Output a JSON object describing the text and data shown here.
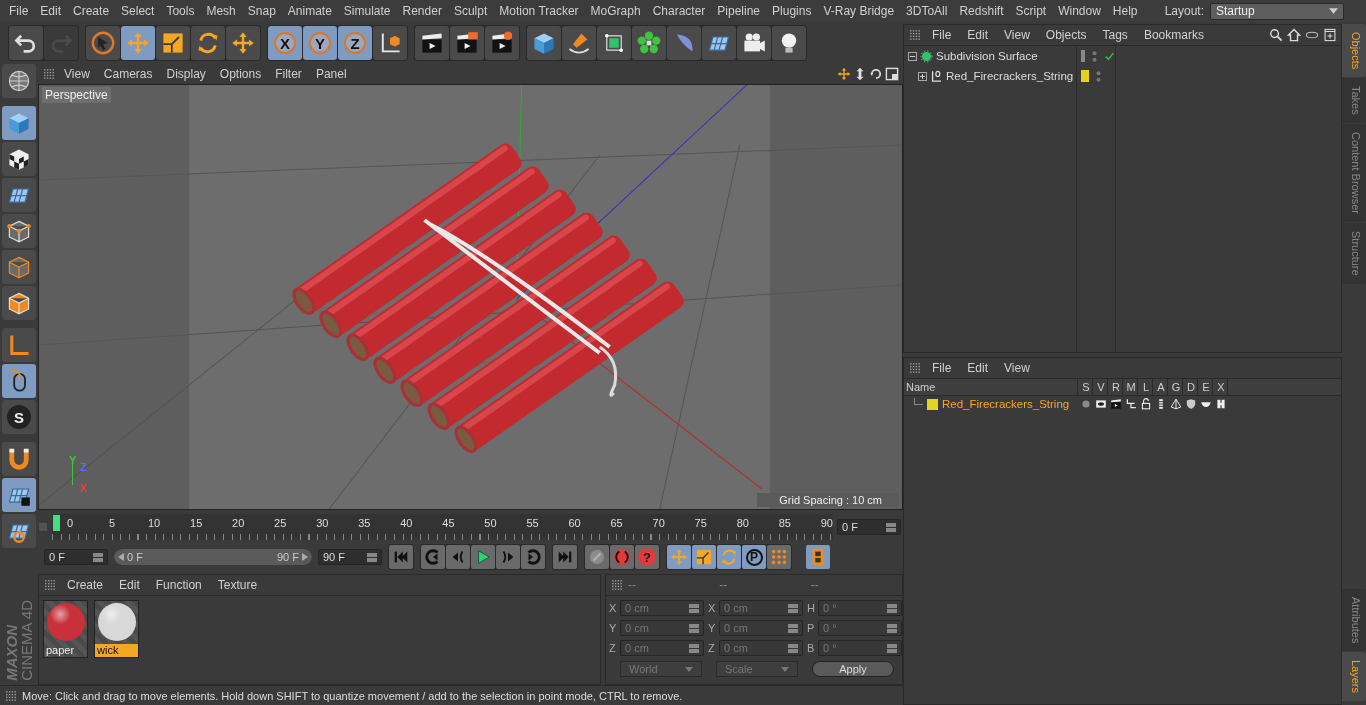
{
  "menubar": {
    "items": [
      "File",
      "Edit",
      "Create",
      "Select",
      "Tools",
      "Mesh",
      "Snap",
      "Animate",
      "Simulate",
      "Render",
      "Sculpt",
      "Motion Tracker",
      "MoGraph",
      "Character",
      "Pipeline",
      "Plugins",
      "V-Ray Bridge",
      "3DToAll",
      "Redshift",
      "Script",
      "Window",
      "Help"
    ],
    "layout_label": "Layout:",
    "layout_value": "Startup"
  },
  "toolbar": {
    "groups": [
      {
        "items": [
          {
            "disabled": false
          },
          {
            "disabled": true
          }
        ]
      },
      {
        "items": [
          {
            "selected": false
          },
          {
            "selected": true
          },
          {
            "selected": false
          },
          {
            "selected": false
          },
          {
            "selected": false
          }
        ]
      },
      {
        "items": [
          {
            "label": "X",
            "selected": true
          },
          {
            "label": "Y",
            "selected": true
          },
          {
            "label": "Z",
            "selected": true
          },
          {
            "selected": false
          }
        ]
      },
      {
        "items": [
          {
            "selected": false
          },
          {
            "selected": false
          },
          {
            "selected": false
          }
        ]
      },
      {
        "items": [
          {
            "selected": false
          },
          {
            "selected": false
          },
          {
            "selected": false
          },
          {
            "selected": false
          },
          {
            "selected": false
          },
          {
            "selected": false
          },
          {
            "selected": false
          },
          {
            "selected": false
          }
        ]
      }
    ]
  },
  "left_toolbar": {
    "tools": [
      {
        "selected": false
      },
      {
        "selected": true
      },
      {
        "selected": false
      },
      {
        "selected": false
      },
      {
        "selected": false
      },
      {
        "selected": false
      },
      {
        "selected": false
      },
      {
        "selected": false
      },
      {
        "selected": true
      },
      {
        "label": "S",
        "selected": false
      },
      {
        "selected": false
      },
      {
        "selected": true
      },
      {
        "selected": false
      }
    ]
  },
  "viewport": {
    "menu": [
      "View",
      "Cameras",
      "Display",
      "Options",
      "Filter",
      "Panel"
    ],
    "camera_label": "Perspective",
    "grid_spacing": "Grid Spacing : 10 cm",
    "axis_labels": [
      {
        "text": "Y",
        "color": "#3ec43e"
      },
      {
        "text": "Z",
        "color": "#5a6cff"
      },
      {
        "text": "X",
        "color": "#e04040"
      }
    ]
  },
  "timeline": {
    "ruler_labels": [
      "0",
      "5",
      "10",
      "15",
      "20",
      "25",
      "30",
      "35",
      "40",
      "45",
      "50",
      "55",
      "60",
      "65",
      "70",
      "75",
      "80",
      "85",
      "90"
    ],
    "current_frame": "0 F",
    "start_field": "0 F",
    "range_start": "0 F",
    "range_end": "90 F",
    "range_slider": {
      "level": 1
    },
    "selection_key_label": "?",
    "end_field": "90 F",
    "key_buttons": [
      {
        "label": "P",
        "selected": true
      }
    ]
  },
  "materials": {
    "menu": [
      "Create",
      "Edit",
      "Function",
      "Texture"
    ],
    "items": [
      {
        "name": "paper",
        "color": "#c8303a",
        "selected": false
      },
      {
        "name": "wick",
        "color": "#d8d8d8",
        "selected": true
      }
    ]
  },
  "coordinates": {
    "headers": [
      "--",
      "--",
      "--"
    ],
    "columns": [
      [
        {
          "axis": "X",
          "value": "0 cm"
        },
        {
          "axis": "Y",
          "value": "0 cm"
        },
        {
          "axis": "Z",
          "value": "0 cm"
        }
      ],
      [
        {
          "axis": "X",
          "value": "0 cm"
        },
        {
          "axis": "Y",
          "value": "0 cm"
        },
        {
          "axis": "Z",
          "value": "0 cm"
        }
      ],
      [
        {
          "axis": "H",
          "value": "0 °"
        },
        {
          "axis": "P",
          "value": "0 °"
        },
        {
          "axis": "B",
          "value": "0 °"
        }
      ]
    ],
    "space": "World",
    "mode": "Scale",
    "apply": "Apply"
  },
  "status_bar": "Move: Click and drag to move elements. Hold down SHIFT to quantize movement / add to the selection in point mode, CTRL to remove.",
  "logo": {
    "brand": "MAXON",
    "product": "CINEMA 4D"
  },
  "object_manager": {
    "menu": [
      "File",
      "Edit",
      "View",
      "Objects",
      "Tags",
      "Bookmarks"
    ],
    "objects": [
      {
        "name": "Subdivision Surface",
        "expanded": true,
        "color": "#8a8a8a",
        "enabled": true,
        "children": [
          {
            "name": "Red_Firecrackers_String",
            "expanded": false,
            "color": "#e0d41e",
            "enabled": false
          }
        ]
      }
    ]
  },
  "layer_manager": {
    "menu": [
      "File",
      "Edit",
      "View"
    ],
    "columns": [
      "Name",
      "S",
      "V",
      "R",
      "M",
      "L",
      "A",
      "G",
      "D",
      "E",
      "X"
    ],
    "layers": [
      {
        "name": "Red_Firecrackers_String",
        "color": "#e0d41e"
      }
    ]
  },
  "side_tabs": {
    "upper": [
      {
        "label": "Objects",
        "selected": true
      },
      {
        "label": "Takes",
        "selected": false
      },
      {
        "label": "Content Browser",
        "selected": false
      },
      {
        "label": "Structure",
        "selected": false
      }
    ],
    "lower": [
      {
        "label": "Attributes",
        "selected": false
      },
      {
        "label": "Layers",
        "selected": true
      }
    ]
  }
}
